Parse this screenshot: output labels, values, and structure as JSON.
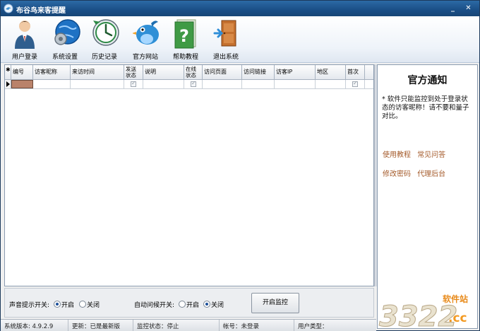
{
  "window": {
    "title": "布谷鸟来客提醒",
    "controls": {
      "minimize": "_",
      "close": "✕"
    }
  },
  "toolbar": {
    "items": [
      {
        "label": "用户登录",
        "icon": "user-icon"
      },
      {
        "label": "系统设置",
        "icon": "gear-globe-icon"
      },
      {
        "label": "历史记录",
        "icon": "clock-icon"
      },
      {
        "label": "官方网站",
        "icon": "bird-icon"
      },
      {
        "label": "帮助教程",
        "icon": "help-book-icon"
      },
      {
        "label": "退出系统",
        "icon": "exit-door-icon"
      }
    ]
  },
  "grid": {
    "columns": [
      "编号",
      "访客昵称",
      "来访时间",
      "发送\n状态",
      "说明",
      "在线\n状态",
      "访问页面",
      "访问链接",
      "访客IP",
      "地区",
      "首次"
    ]
  },
  "notice": {
    "title": "官方通知",
    "text": "* 软件只能监控到处于登录状态的访客昵称！请不要和量子对比。",
    "links_row1": [
      "使用教程",
      "常见问答"
    ],
    "links_row2": [
      "修改密码",
      "代理后台"
    ]
  },
  "controls": {
    "sound_label": "声音提示开关:",
    "sound_on": "开启",
    "sound_off": "关闭",
    "auto_greet_label": "自动问候开关:",
    "auto_on": "开启",
    "auto_off": "关闭",
    "start_button": "开启监控"
  },
  "statusbar": {
    "version": "系统版本: 4.9.2.9",
    "update": "更新：已是最新版",
    "monitor": "监控状态：停止",
    "account": "帐号：未登录",
    "user_type": "用户类型："
  },
  "watermark": {
    "brand": "3322",
    "domain": ".cc",
    "site": "软件站"
  },
  "colors": {
    "titlebar": "#1a4e86",
    "link": "#a45a2a",
    "selected_cell": "#b9826a"
  }
}
